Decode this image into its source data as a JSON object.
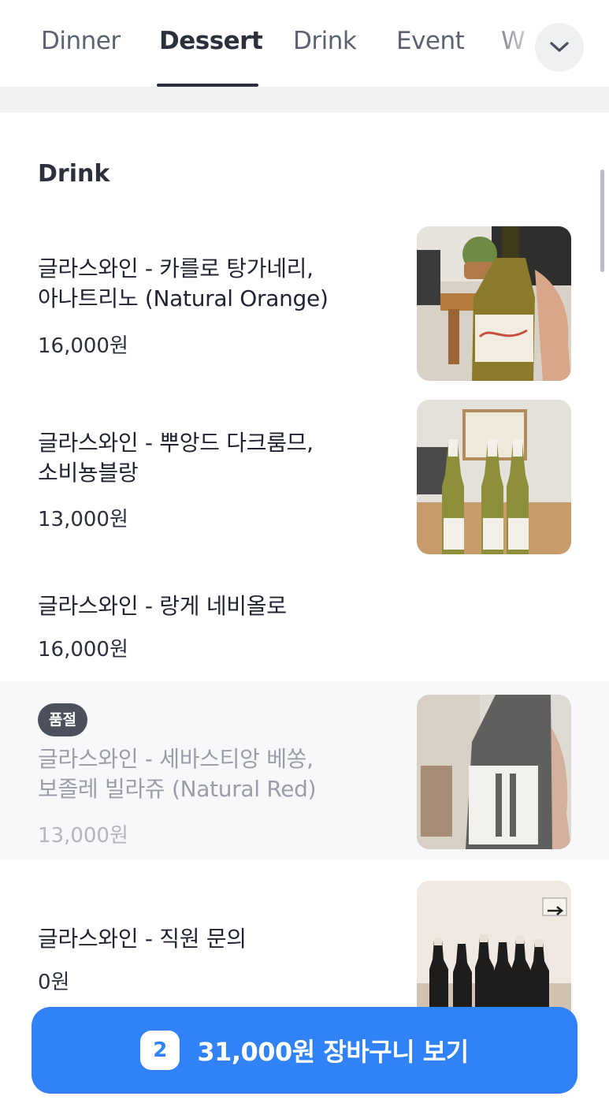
{
  "tabs": [
    {
      "label": "Dinner"
    },
    {
      "label": "Dessert"
    },
    {
      "label": "Drink"
    },
    {
      "label": "Event"
    },
    {
      "label": "W"
    }
  ],
  "section": {
    "title": "Drink"
  },
  "items": [
    {
      "name_line1": "글라스와인 - 카를로 탕가네리,",
      "name_line2": "아나트리노 (Natural Orange)",
      "price": "16,000원"
    },
    {
      "name_line1": "글라스와인 - 뿌앙드 다크룸므,",
      "name_line2": "소비뇽블랑",
      "price": "13,000원"
    },
    {
      "name_line1": "글라스와인 - 랑게 네비올로",
      "price": "16,000원"
    },
    {
      "badge": "품절",
      "name_line1": "글라스와인 - 세바스티앙 베쏭,",
      "name_line2": "보졸레 빌라쥬 (Natural Red)",
      "price": "13,000원"
    },
    {
      "name_line1": "글라스와인 - 직원 문의",
      "price": "0원"
    }
  ],
  "cart": {
    "count": "2",
    "label": "31,000원 장바구니 보기"
  },
  "colors": {
    "accent": "#3182f6",
    "active_tab": "#2b303b",
    "badge": "#4b505c"
  }
}
